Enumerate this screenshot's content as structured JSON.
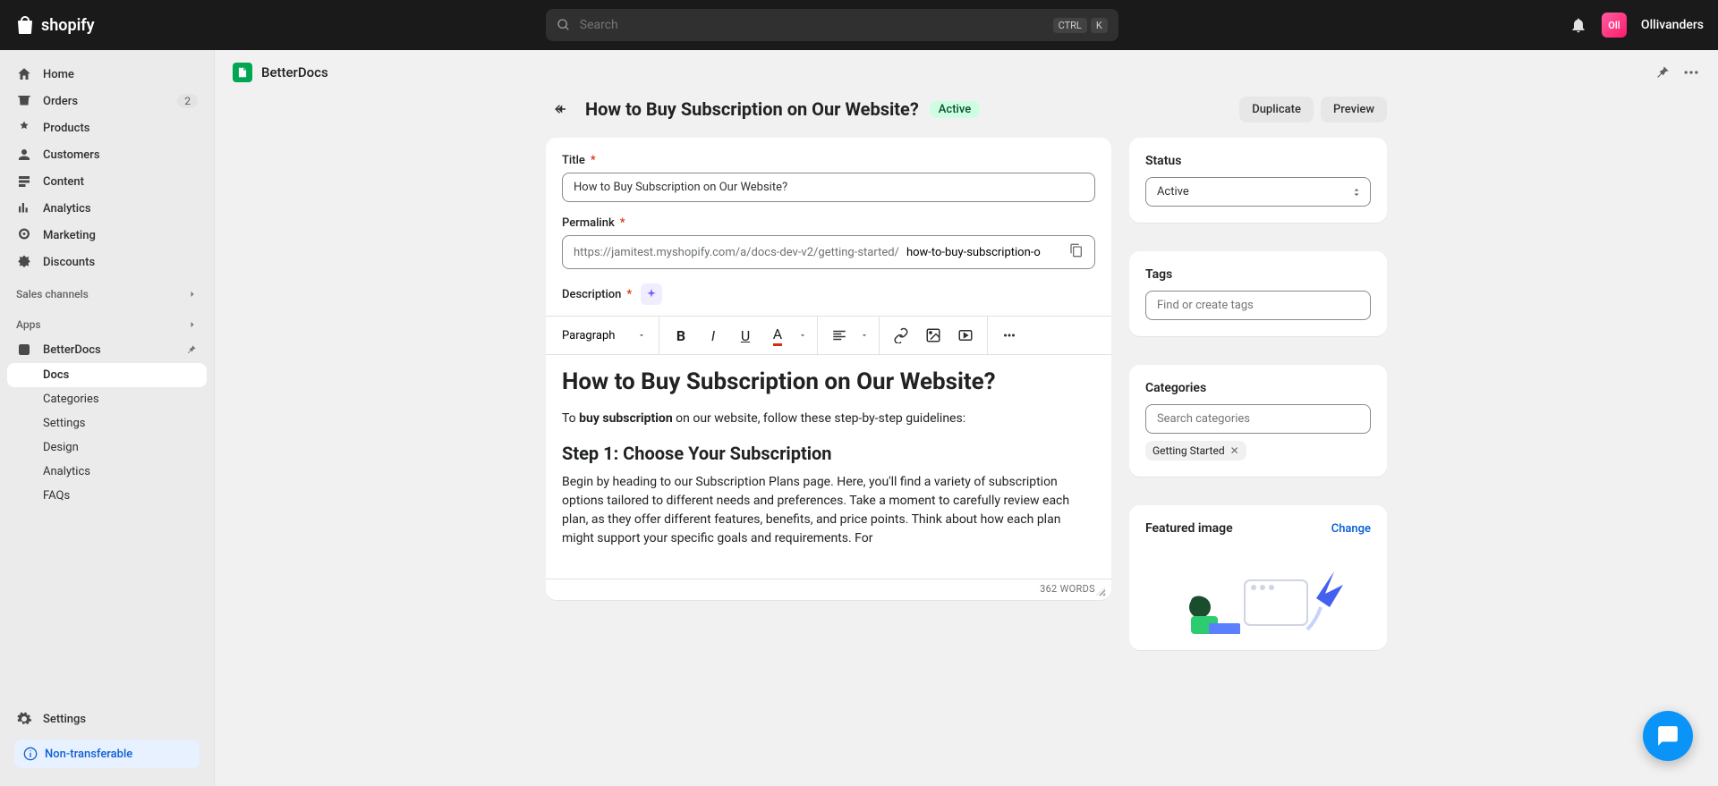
{
  "topbar": {
    "brand": "shopify",
    "search_placeholder": "Search",
    "kbd1": "CTRL",
    "kbd2": "K",
    "store_name": "Ollivanders",
    "avatar_initials": "Oll"
  },
  "sidebar": {
    "home": "Home",
    "orders": "Orders",
    "orders_badge": "2",
    "products": "Products",
    "customers": "Customers",
    "content": "Content",
    "analytics": "Analytics",
    "marketing": "Marketing",
    "discounts": "Discounts",
    "sales_channels": "Sales channels",
    "apps": "Apps",
    "betterdocs": "BetterDocs",
    "sub_docs": "Docs",
    "sub_categories": "Categories",
    "sub_settings": "Settings",
    "sub_design": "Design",
    "sub_analytics": "Analytics",
    "sub_faqs": "FAQs",
    "settings": "Settings",
    "non_transferable": "Non-transferable"
  },
  "appbar": {
    "title": "BetterDocs"
  },
  "page": {
    "title": "How to Buy Subscription on Our Website?",
    "status_badge": "Active",
    "duplicate": "Duplicate",
    "preview": "Preview"
  },
  "form": {
    "title_label": "Title",
    "title_value": "How to Buy Subscription on Our Website?",
    "permalink_label": "Permalink",
    "permalink_prefix": "https://jamitest.myshopify.com/a/docs-dev-v2/getting-started/",
    "permalink_value": "how-to-buy-subscription-o",
    "description_label": "Description",
    "block_style": "Paragraph",
    "word_count": "362 WORDS",
    "body_h1": "How to Buy Subscription on Our Website?",
    "body_p1a": "To ",
    "body_p1b": "buy subscription",
    "body_p1c": " on our website, follow these step-by-step guidelines:",
    "body_h2": "Step 1: Choose Your Subscription",
    "body_p2": "Begin by heading to our Subscription Plans page. Here, you'll find a variety of subscription options tailored to different needs and preferences. Take a moment to carefully review each plan, as they offer different features, benefits, and price points. Think about how each plan might support your specific goals and requirements. For"
  },
  "side": {
    "status_label": "Status",
    "status_value": "Active",
    "tags_label": "Tags",
    "tags_placeholder": "Find or create tags",
    "categories_label": "Categories",
    "categories_placeholder": "Search categories",
    "category_chip": "Getting Started",
    "featured_label": "Featured image",
    "change": "Change"
  }
}
